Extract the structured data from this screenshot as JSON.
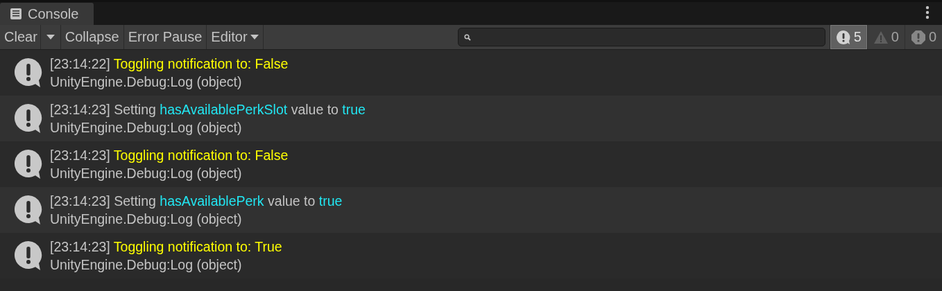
{
  "tab": {
    "title": "Console"
  },
  "toolbar": {
    "clear": "Clear",
    "collapse": {
      "label": "Collapse",
      "selected": false
    },
    "error_pause": {
      "label": "Error Pause",
      "selected": false
    },
    "editor": "Editor",
    "counts": [
      {
        "kind": "info",
        "count": "5",
        "selected": true
      },
      {
        "kind": "warning",
        "count": "0",
        "selected": false
      },
      {
        "kind": "error",
        "count": "0",
        "selected": false
      }
    ]
  },
  "entries": [
    {
      "kind": "info",
      "message": [
        {
          "text": "[23:14:22] ",
          "color": "#c4c4c4"
        },
        {
          "text": "Toggling notification to: False",
          "color": "#ffff00"
        }
      ],
      "trace": "UnityEngine.Debug:Log (object)"
    },
    {
      "kind": "info",
      "message": [
        {
          "text": "[23:14:23] Setting ",
          "color": "#c4c4c4"
        },
        {
          "text": "hasAvailablePerkSlot",
          "color": "#22e6f2"
        },
        {
          "text": " value to ",
          "color": "#c4c4c4"
        },
        {
          "text": "true",
          "color": "#22e6f2"
        }
      ],
      "trace": "UnityEngine.Debug:Log (object)"
    },
    {
      "kind": "info",
      "message": [
        {
          "text": "[23:14:23] ",
          "color": "#c4c4c4"
        },
        {
          "text": "Toggling notification to: False",
          "color": "#ffff00"
        }
      ],
      "trace": "UnityEngine.Debug:Log (object)"
    },
    {
      "kind": "info",
      "message": [
        {
          "text": "[23:14:23] Setting ",
          "color": "#c4c4c4"
        },
        {
          "text": "hasAvailablePerk",
          "color": "#22e6f2"
        },
        {
          "text": " value to ",
          "color": "#c4c4c4"
        },
        {
          "text": "true",
          "color": "#22e6f2"
        }
      ],
      "trace": "UnityEngine.Debug:Log (object)"
    },
    {
      "kind": "info",
      "message": [
        {
          "text": "[23:14:23] ",
          "color": "#c4c4c4"
        },
        {
          "text": "Toggling notification to: True",
          "color": "#ffff00"
        }
      ],
      "trace": "UnityEngine.Debug:Log (object)"
    }
  ]
}
